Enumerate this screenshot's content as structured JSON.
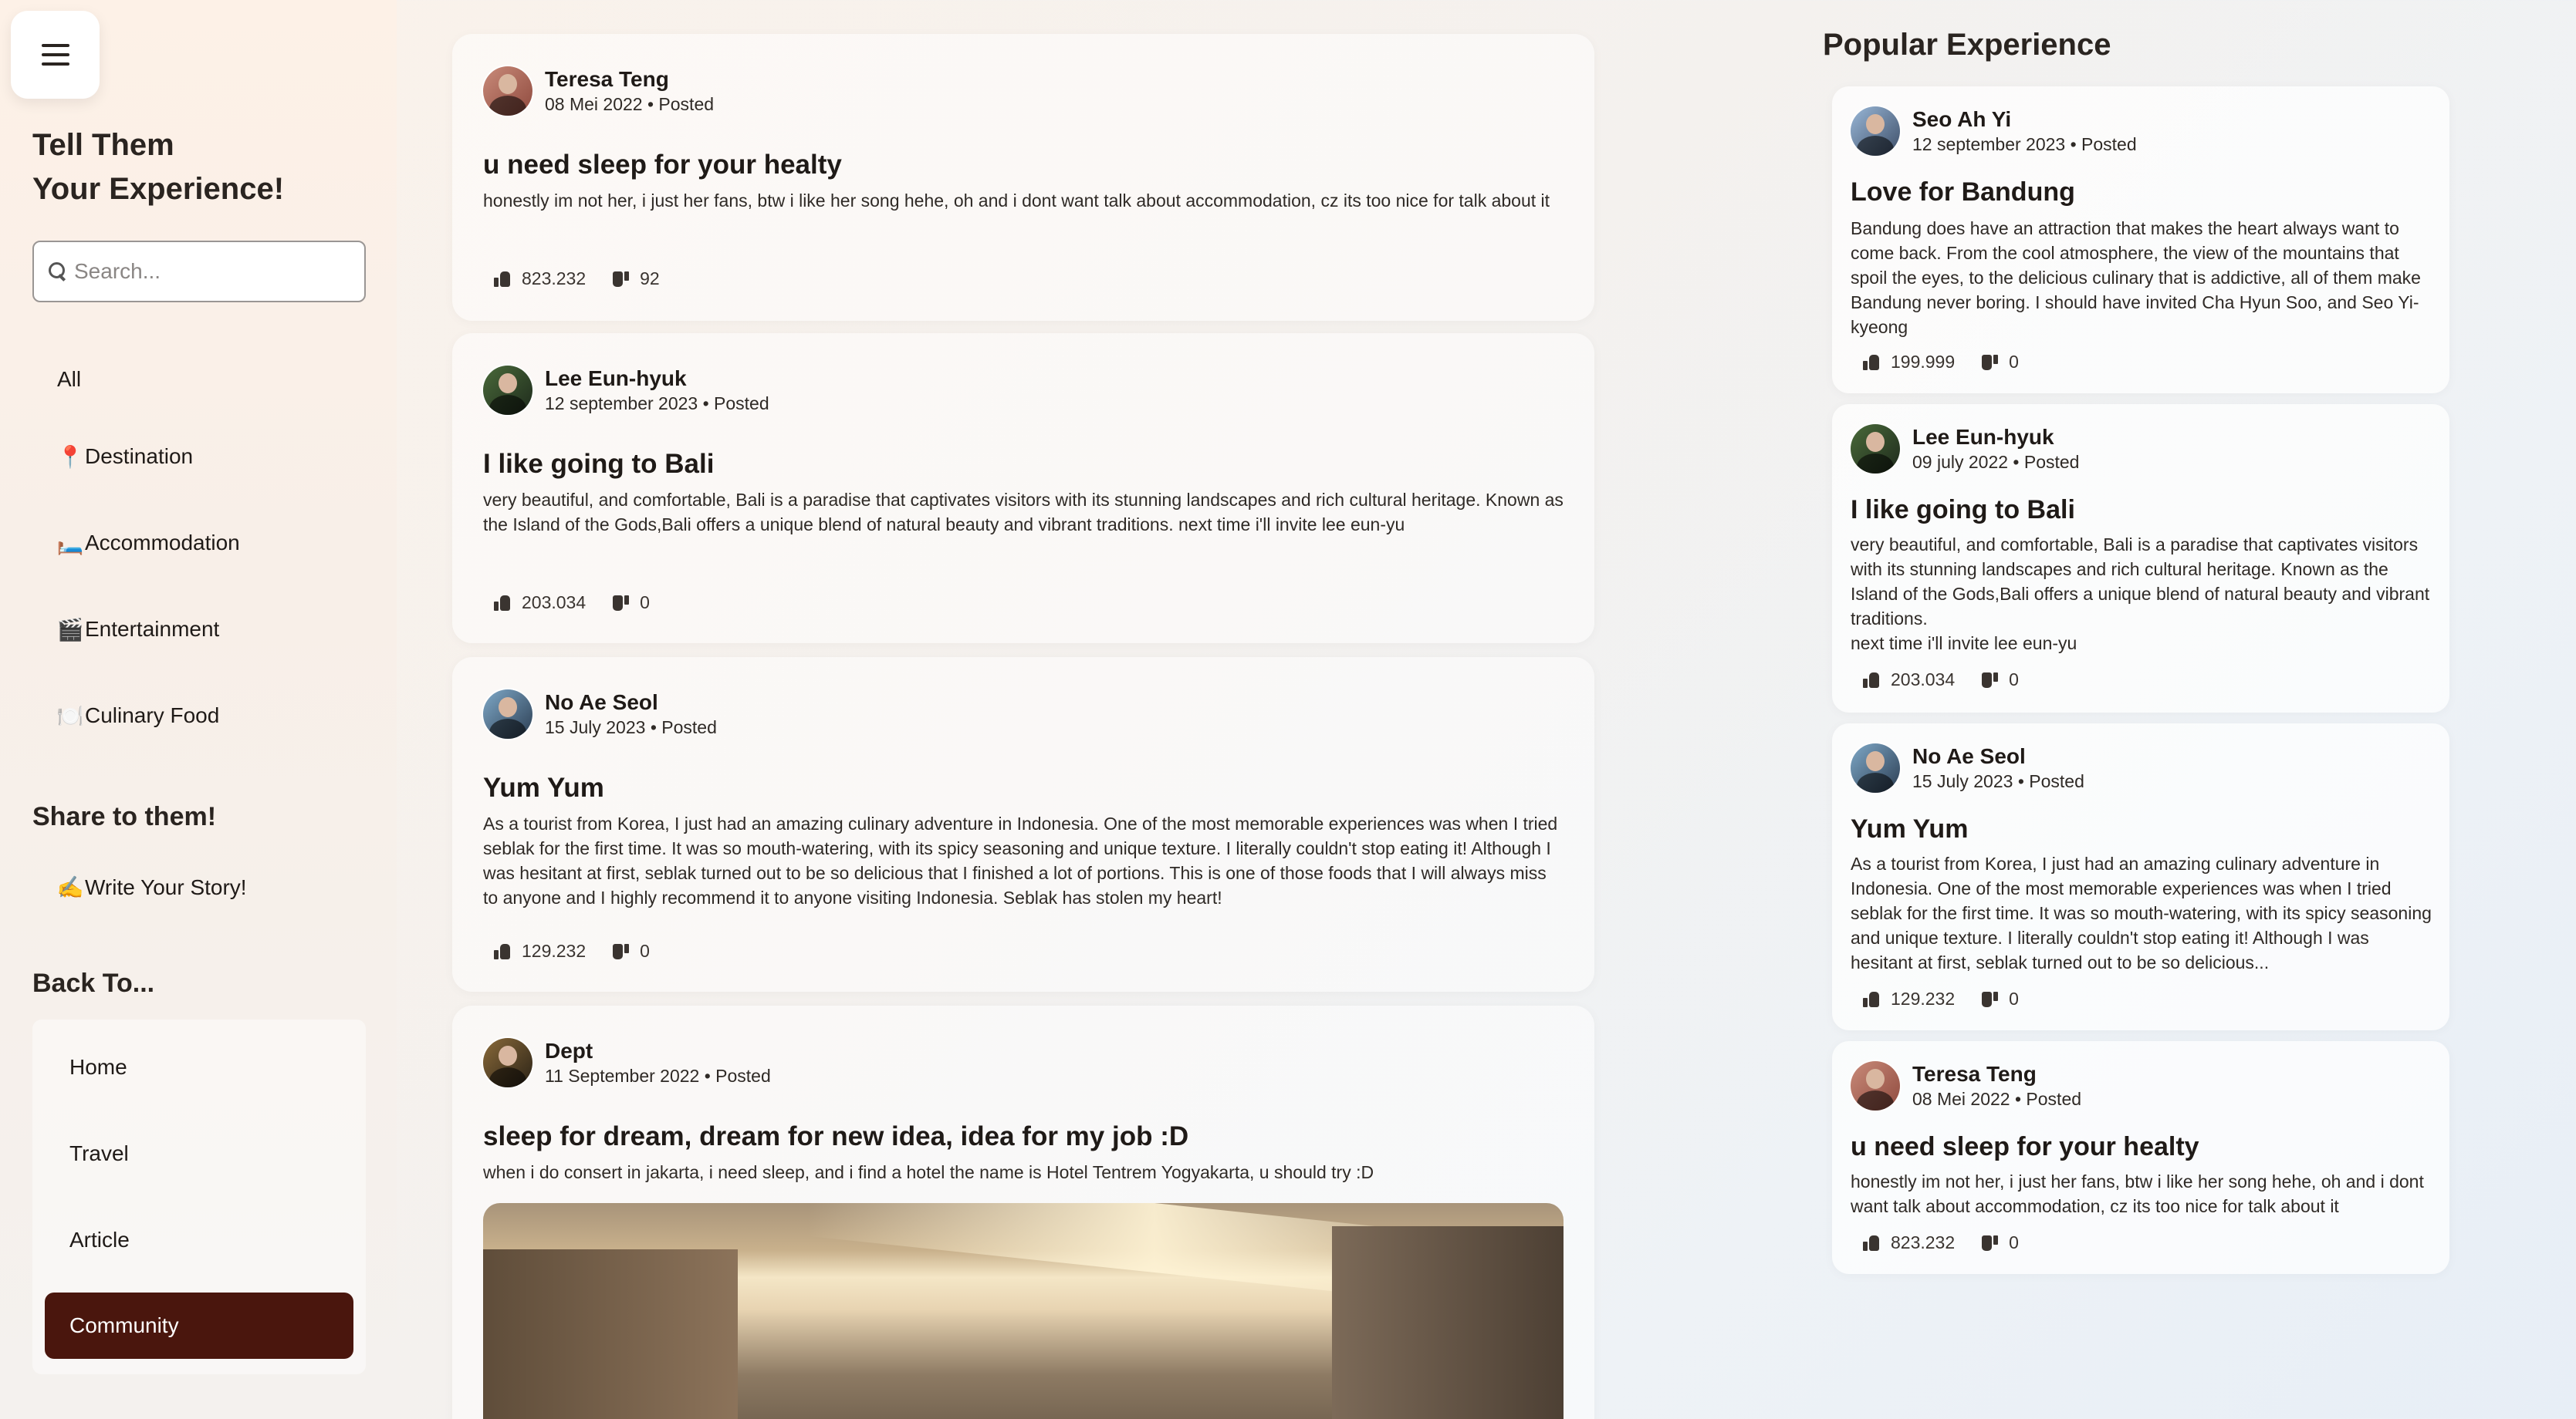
{
  "sidebar": {
    "title_line1": "Tell Them",
    "title_line2": "Your Experience!",
    "search_placeholder": "Search...",
    "categories": [
      {
        "emoji": "",
        "label": "All"
      },
      {
        "emoji": "📍",
        "label": "Destination"
      },
      {
        "emoji": "🛏️",
        "label": "Accommodation"
      },
      {
        "emoji": "🎬",
        "label": "Entertainment"
      },
      {
        "emoji": "🍽️",
        "label": "Culinary Food"
      }
    ],
    "share_title": "Share to them!",
    "write_emoji": "✍️",
    "write_label": "Write Your Story!",
    "back_title": "Back To...",
    "back_items": [
      "Home",
      "Travel",
      "Article"
    ],
    "active_item": "Community",
    "active_color": "#4a160d"
  },
  "feed": [
    {
      "author": "Teresa Teng",
      "meta": "08 Mei 2022 • Posted",
      "title": "u need sleep for your healty",
      "body": "honestly im not her, i just her fans, btw i like her song hehe, oh and i dont want talk about accommodation, cz its too nice for talk about it",
      "likes": "823.232",
      "dislikes": "92"
    },
    {
      "author": "Lee Eun-hyuk",
      "meta": "12 september 2023 • Posted",
      "title": "I like going to Bali",
      "body": "very beautiful, and comfortable, Bali is a paradise that captivates visitors with its stunning landscapes and rich cultural heritage. Known as the Island of the Gods,Bali offers a unique blend of natural beauty and vibrant traditions. next time i'll invite lee eun-yu",
      "likes": "203.034",
      "dislikes": "0"
    },
    {
      "author": "No Ae Seol",
      "meta": "15 July 2023 • Posted",
      "title": "Yum Yum",
      "body": "As a tourist from Korea, I just had an amazing culinary adventure in Indonesia. One of the most memorable experiences was when I tried seblak for the first time. It was so mouth-watering, with its spicy seasoning and unique texture. I literally couldn't stop eating it! Although I was hesitant at first, seblak turned out to be so delicious that I finished a lot of portions. This is one of those foods that I will always miss to anyone and I highly recommend it to anyone visiting Indonesia. Seblak has stolen my heart!",
      "likes": "129.232",
      "dislikes": "0"
    },
    {
      "author": "Dept",
      "meta": "11 September 2022 • Posted",
      "title": "sleep for dream, dream for new idea, idea for my job :D",
      "body": "when i do consert in jakarta, i need sleep, and i find a hotel the name is Hotel Tentrem Yogyakarta, u should try :D"
    }
  ],
  "popular": {
    "title": "Popular Experience",
    "items": [
      {
        "author": "Seo Ah Yi",
        "meta": "12 september 2023 • Posted",
        "title": "Love for Bandung",
        "body": "Bandung does have an attraction that makes the heart always want to come back. From the cool atmosphere, the view of the mountains that spoil the eyes, to the delicious culinary that is addictive, all of them make Bandung never boring. I should have invited Cha Hyun Soo, and Seo Yi-kyeong",
        "likes": "199.999",
        "dislikes": "0"
      },
      {
        "author": "Lee Eun-hyuk",
        "meta": "09 july 2022 • Posted",
        "title": "I like going to Bali",
        "body": "very beautiful, and comfortable, Bali is a paradise that captivates visitors with its stunning landscapes and rich cultural heritage. Known as the Island of the Gods,Bali offers a unique blend of natural beauty and vibrant traditions.",
        "body2": "next time i'll invite lee eun-yu",
        "likes": "203.034",
        "dislikes": "0"
      },
      {
        "author": "No Ae Seol",
        "meta": "15 July 2023 • Posted",
        "title": "Yum Yum",
        "body": "As a tourist from Korea, I just had an amazing culinary adventure in Indonesia. One of the most memorable experiences was when I tried seblak for the first time. It was so mouth-watering, with its spicy seasoning and unique texture. I literally couldn't stop eating it! Although I was hesitant at first, seblak turned out to be so delicious...",
        "likes": "129.232",
        "dislikes": "0"
      },
      {
        "author": "Teresa Teng",
        "meta": "08 Mei 2022 • Posted",
        "title": "u need sleep for your healty",
        "body": "honestly im not her, i just her fans, btw i like her song hehe, oh and i dont want talk about accommodation, cz its too nice for talk about it",
        "likes": "823.232",
        "dislikes": "0"
      }
    ]
  }
}
